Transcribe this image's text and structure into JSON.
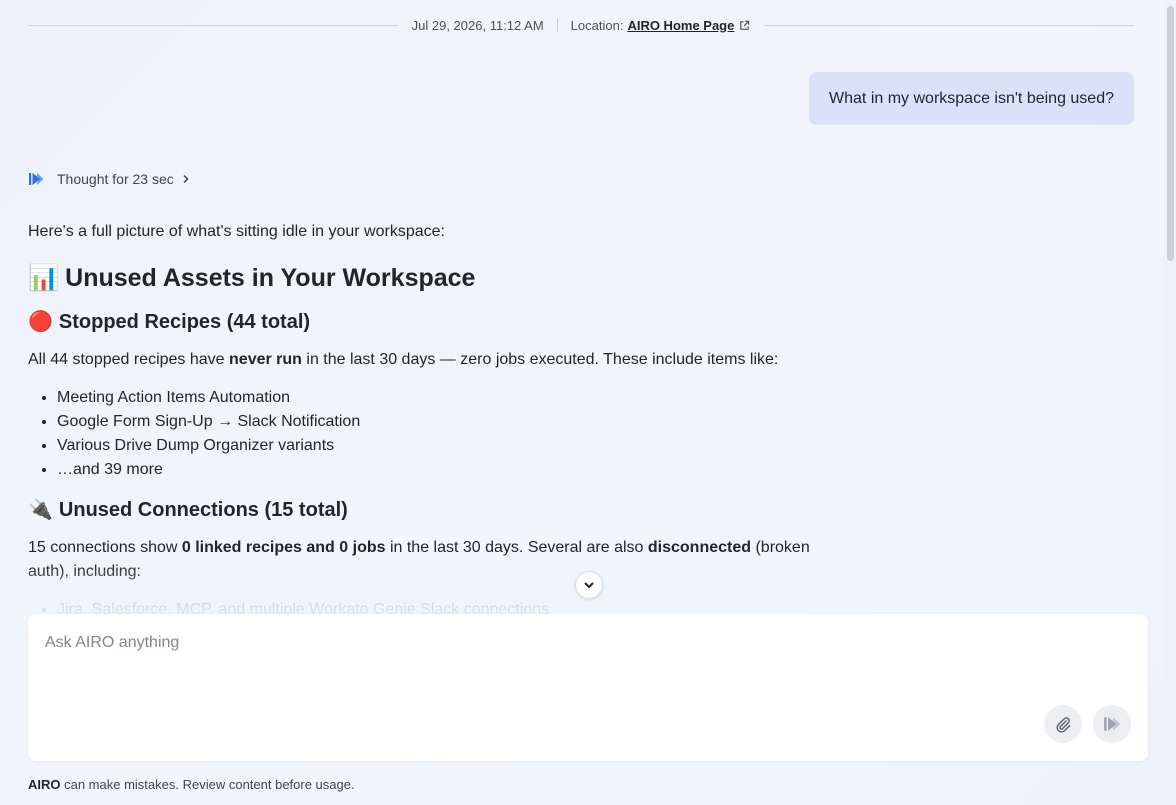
{
  "meta": {
    "timestamp": "Jul 29, 2026, 11:12 AM",
    "location_label": "Location:",
    "location_link": "AIRO Home Page"
  },
  "user_message": "What in my workspace isn't being used?",
  "thought": {
    "label": "Thought for 23 sec"
  },
  "response": {
    "intro": "Here's a full picture of what's sitting idle in your workspace:",
    "title_emoji": "📊",
    "title": "Unused Assets in Your Workspace",
    "sections": [
      {
        "emoji": "🔴",
        "heading": "Stopped Recipes (44 total)",
        "para_pre": "All 44 stopped recipes have ",
        "para_bold1": "never run",
        "para_mid": " in the last 30 days — zero jobs executed. These include items like:",
        "items": [
          "Meeting Action Items Automation",
          "Google Form Sign-Up → Slack Notification",
          "Various Drive Dump Organizer variants",
          "…and 39 more"
        ]
      },
      {
        "emoji": "🔌",
        "heading": "Unused Connections (15 total)",
        "para_pre": "15 connections show ",
        "para_bold1": "0 linked recipes and 0 jobs",
        "para_mid": " in the last 30 days. Several are also ",
        "para_bold2": "disconnected",
        "para_post": " (broken auth), including:",
        "items": [
          "Jira, Salesforce, MCP, and multiple Workato Genie Slack connections"
        ]
      }
    ]
  },
  "composer": {
    "placeholder": "Ask AIRO anything"
  },
  "footer": {
    "brand": "AIRO",
    "disclaimer": " can make mistakes. Review content before usage."
  },
  "icons": {
    "external_link": "external-link-icon",
    "airo": "airo-logo-icon",
    "chevron_right": "chevron-right-icon",
    "chevron_down": "chevron-down-icon",
    "attach": "paperclip-icon",
    "send": "send-icon"
  },
  "colors": {
    "accent": "#2f6fe0",
    "user_bubble": "#d9e2f8",
    "background": "#eef2fb"
  }
}
